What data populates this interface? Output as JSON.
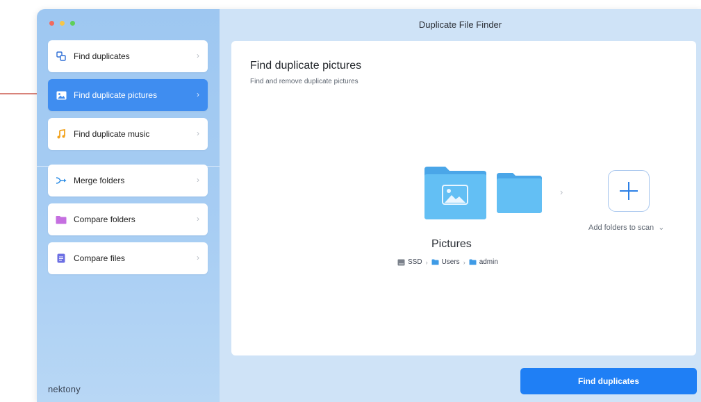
{
  "window": {
    "title": "Duplicate File Finder"
  },
  "sidebar": {
    "items": [
      {
        "label": "Find duplicates",
        "icon": "duplicates-icon",
        "active": false
      },
      {
        "label": "Find duplicate pictures",
        "icon": "picture-icon",
        "active": true
      },
      {
        "label": "Find duplicate music",
        "icon": "music-note-icon",
        "active": false
      },
      {
        "label": "Merge folders",
        "icon": "merge-icon",
        "active": false
      },
      {
        "label": "Compare folders",
        "icon": "folder-icon",
        "active": false
      },
      {
        "label": "Compare files",
        "icon": "file-icon",
        "active": false
      }
    ],
    "brand": "nektony"
  },
  "main": {
    "title": "Find duplicate pictures",
    "subtitle": "Find and remove duplicate pictures",
    "folder_name": "Pictures",
    "path": [
      "SSD",
      "Users",
      "admin"
    ],
    "add_label": "Add folders to scan"
  },
  "actions": {
    "find_button": "Find duplicates"
  },
  "colors": {
    "accent": "#1f7ff5",
    "active_item": "#3f8df0",
    "folder": "#5fb8f0",
    "annotation_arrow": "#c0392b"
  }
}
